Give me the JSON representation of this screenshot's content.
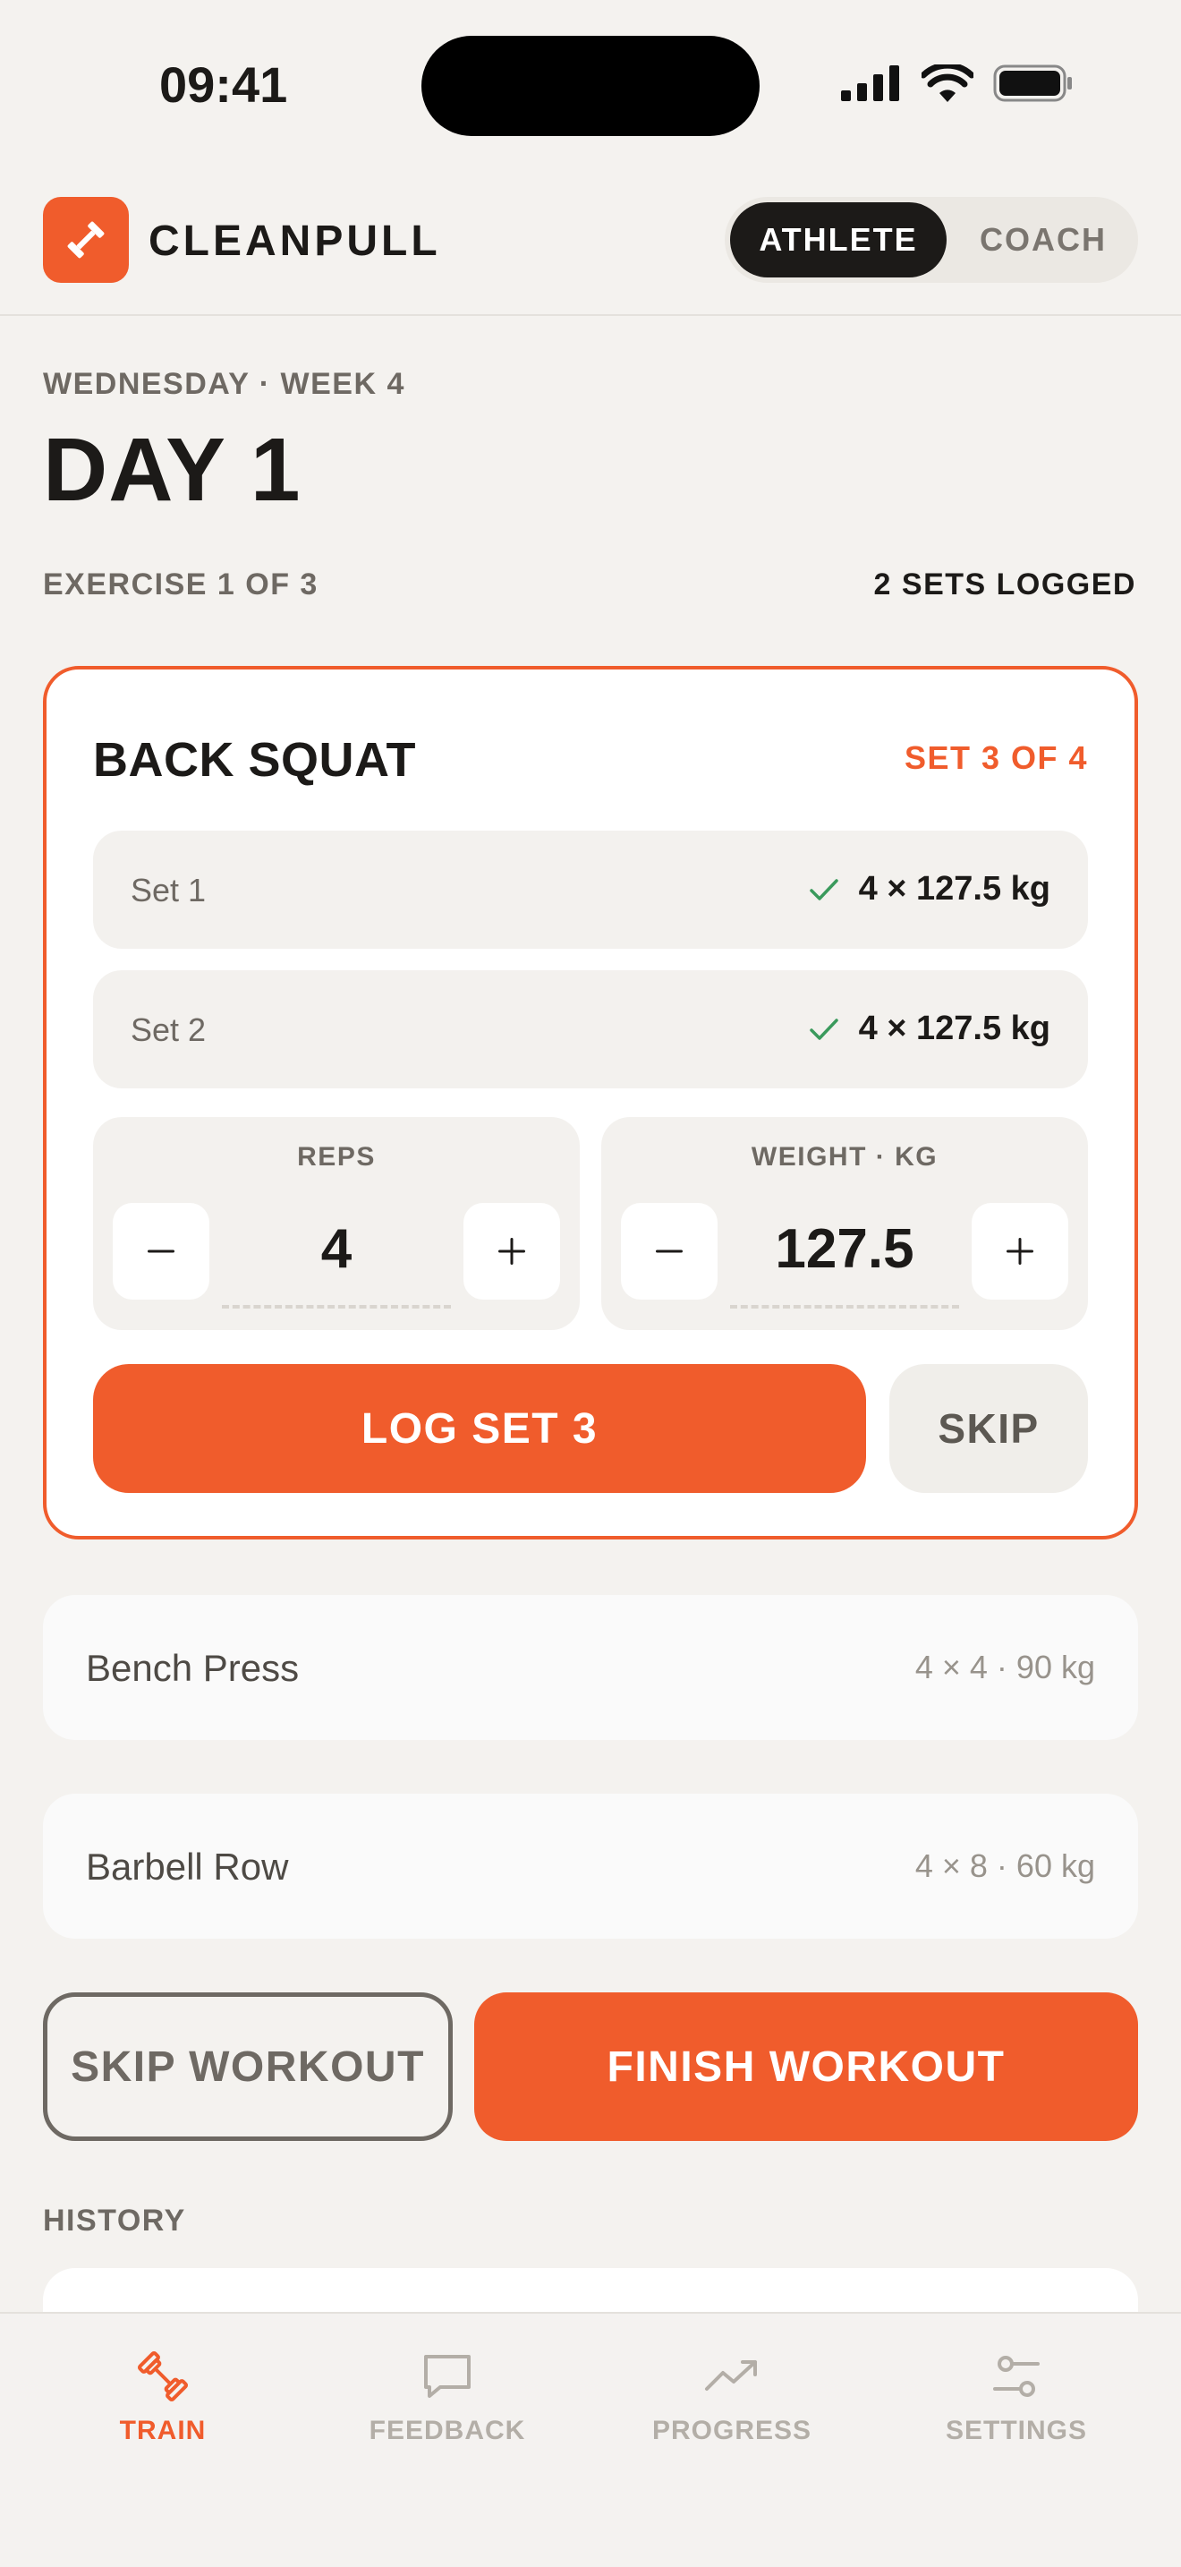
{
  "status_bar": {
    "time": "09:41"
  },
  "header": {
    "brand": "CLEANPULL",
    "roles": [
      {
        "label": "ATHLETE",
        "active": true
      },
      {
        "label": "COACH",
        "active": false
      }
    ]
  },
  "day": {
    "subtitle": "WEDNESDAY · WEEK 4",
    "title": "DAY 1",
    "exercise_progress": "EXERCISE 1 OF 3",
    "sets_logged": "2 SETS LOGGED"
  },
  "active_exercise": {
    "name": "BACK SQUAT",
    "set_counter": "SET 3 OF 4",
    "completed_sets": [
      {
        "label": "Set 1",
        "result": "4 × 127.5 kg"
      },
      {
        "label": "Set 2",
        "result": "4 × 127.5 kg"
      }
    ],
    "reps": {
      "label": "REPS",
      "value": "4"
    },
    "weight": {
      "label": "WEIGHT · KG",
      "value": "127.5"
    },
    "log_label": "LOG SET 3",
    "skip_label": "SKIP"
  },
  "upcoming": [
    {
      "name": "Bench Press",
      "detail": "4 × 4 · 90 kg"
    },
    {
      "name": "Barbell Row",
      "detail": "4 × 8 · 60 kg"
    }
  ],
  "actions": {
    "skip_workout": "SKIP WORKOUT",
    "finish_workout": "FINISH WORKOUT"
  },
  "history": {
    "title": "HISTORY"
  },
  "tabs": [
    {
      "label": "TRAIN",
      "icon": "dumbbell-icon",
      "active": true
    },
    {
      "label": "FEEDBACK",
      "icon": "chat-bubble-icon",
      "active": false
    },
    {
      "label": "PROGRESS",
      "icon": "trend-up-icon",
      "active": false
    },
    {
      "label": "SETTINGS",
      "icon": "sliders-icon",
      "active": false
    }
  ],
  "colors": {
    "accent": "#f05c2c",
    "background": "#f4f2ef",
    "text": "#1c1a18",
    "muted": "#6e6963",
    "success": "#3a9a5c"
  }
}
